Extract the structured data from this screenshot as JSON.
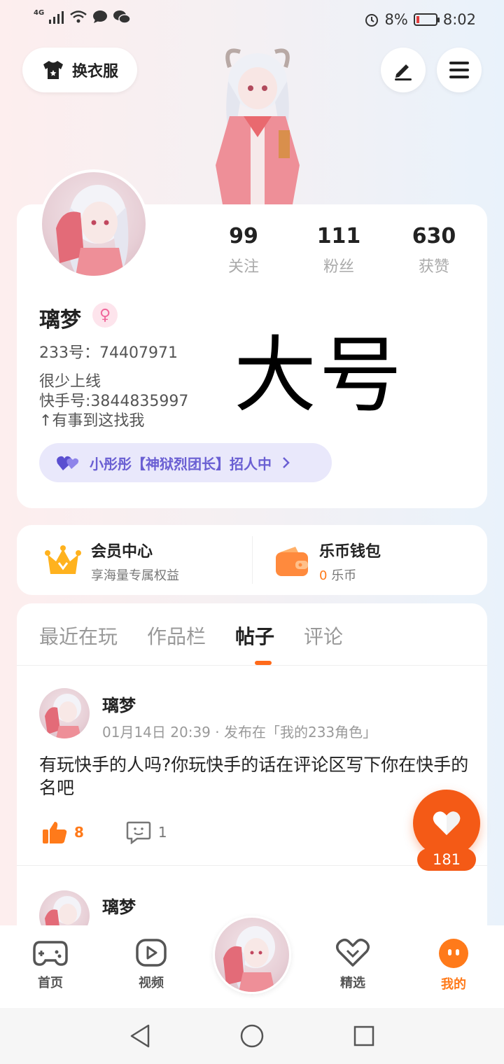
{
  "status_bar": {
    "network": "4G",
    "battery": "8%",
    "time": "8:02"
  },
  "header": {
    "outfit_label": "换衣服"
  },
  "profile": {
    "username": "璃梦",
    "uid": "233号：74407971",
    "bio": "很少上线\n快手号:3844835997\n↑有事到这找我",
    "overlay_text": "大号",
    "stats": [
      {
        "num": "99",
        "label": "关注"
      },
      {
        "num": "111",
        "label": "粉丝"
      },
      {
        "num": "630",
        "label": "获赞"
      }
    ],
    "guild_text": "小彤彤【神狱烈团长】招人中"
  },
  "member": {
    "title": "会员中心",
    "subtitle": "享海量专属权益"
  },
  "wallet": {
    "title": "乐币钱包",
    "amount": "0",
    "unit": "乐币"
  },
  "tabs": [
    "最近在玩",
    "作品栏",
    "帖子",
    "评论"
  ],
  "active_tab_index": 2,
  "posts": [
    {
      "author": "璃梦",
      "meta": "01月14日 20:39 · 发布在「我的233角色」",
      "content": "有玩快手的人吗?你玩快手的话在评论区写下你在快手的名吧",
      "likes": "8",
      "comments": "1"
    },
    {
      "author": "璃梦"
    }
  ],
  "fab": {
    "count": "181"
  },
  "bottom_nav": [
    {
      "label": "首页"
    },
    {
      "label": "视频"
    },
    {
      "label": "精选"
    },
    {
      "label": "我的"
    }
  ],
  "colors": {
    "accent": "#ff7a1a",
    "fab": "#f45a16",
    "guild_text": "#6a5fd3"
  }
}
